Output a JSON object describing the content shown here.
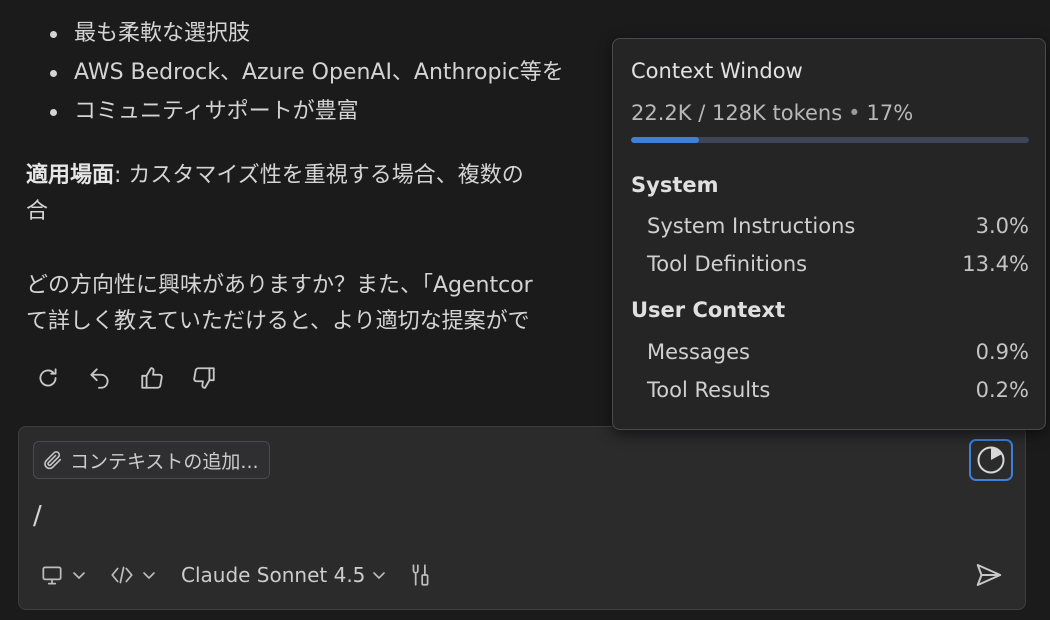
{
  "chat": {
    "bullets": [
      "最も柔軟な選択肢",
      "AWS Bedrock、Azure OpenAI、Anthropic等を",
      "コミュニティサポートが豊富"
    ],
    "p1": {
      "label": "適用場面",
      "text": ": カスタマイズ性を重視する場合、複数の",
      "cont": "合"
    },
    "p2": {
      "line1": "どの方向性に興味がありますか？また、「Agentcor",
      "line2": "て詳しく教えていただけると、より適切な提案がで"
    },
    "actions": [
      "retry-icon",
      "undo-icon",
      "thumbs-up-icon",
      "thumbs-down-icon"
    ]
  },
  "input": {
    "context_label": "コンテキストの追加...",
    "text": "/",
    "model": "Claude Sonnet 4.5"
  },
  "context_window": {
    "title": "Context Window",
    "usage": "22.2K / 128K tokens",
    "percent_label": "17%",
    "percent": 17,
    "sections": [
      {
        "name": "System",
        "items": [
          {
            "label": "System Instructions",
            "value": "3.0%"
          },
          {
            "label": "Tool Definitions",
            "value": "13.4%"
          }
        ]
      },
      {
        "name": "User Context",
        "items": [
          {
            "label": "Messages",
            "value": "0.9%"
          },
          {
            "label": "Tool Results",
            "value": "0.2%"
          }
        ]
      }
    ]
  },
  "colors": {
    "accent": "#3f7fd6",
    "background": "#1b1b1c",
    "panel": "#2b2b2c"
  }
}
